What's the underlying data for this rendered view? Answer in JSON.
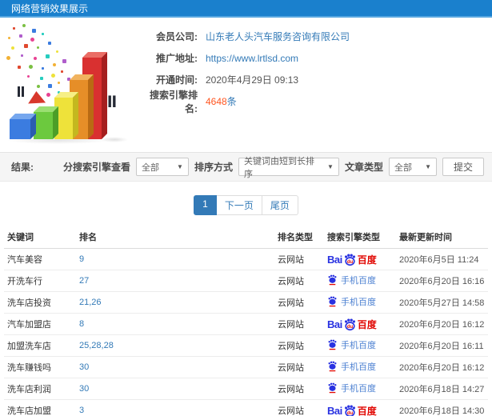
{
  "header": {
    "title": "网络营销效果展示"
  },
  "info": {
    "rows": [
      {
        "label": "会员公司:",
        "value": "山东老人头汽车服务咨询有限公司"
      },
      {
        "label": "推广地址:",
        "value": "https://www.lrtlsd.com"
      },
      {
        "label": "开通时间:",
        "value": "2020年4月29日 09:13"
      },
      {
        "label": "搜索引擎排名:",
        "value": "4648",
        "suffix": "条"
      }
    ]
  },
  "filters": {
    "result_label": "结果:",
    "engine_filter_label": "分搜索引擎查看",
    "engine_filter_value": "全部",
    "sort_label": "排序方式",
    "sort_value": "关键词由短到长排序",
    "article_type_label": "文章类型",
    "article_type_value": "全部",
    "submit_label": "提交",
    "caret": "▼"
  },
  "pagination": {
    "current": "1",
    "next_label": "下一页",
    "last_label": "尾页"
  },
  "table": {
    "headers": [
      "关键词",
      "排名",
      "排名类型",
      "搜索引擎类型",
      "最新更新时间"
    ],
    "engines": {
      "baidu": {
        "latin": "Bai",
        "du": "du",
        "cn": "百度"
      },
      "mobile": {
        "cn": "手机百度"
      }
    },
    "rows": [
      {
        "keyword": "汽车美容",
        "rank": "9",
        "rank_type": "云网站",
        "engine": "baidu",
        "updated": "2020年6月5日 11:24"
      },
      {
        "keyword": "开洗车行",
        "rank": "27",
        "rank_type": "云网站",
        "engine": "mobile",
        "updated": "2020年6月20日 16:16"
      },
      {
        "keyword": "洗车店投资",
        "rank": "21,26",
        "rank_type": "云网站",
        "engine": "mobile",
        "updated": "2020年5月27日 14:58"
      },
      {
        "keyword": "汽车加盟店",
        "rank": "8",
        "rank_type": "云网站",
        "engine": "baidu",
        "updated": "2020年6月20日 16:12"
      },
      {
        "keyword": "加盟洗车店",
        "rank": "25,28,28",
        "rank_type": "云网站",
        "engine": "mobile",
        "updated": "2020年6月20日 16:11"
      },
      {
        "keyword": "洗车赚钱吗",
        "rank": "30",
        "rank_type": "云网站",
        "engine": "mobile",
        "updated": "2020年6月20日 16:12"
      },
      {
        "keyword": "洗车店利润",
        "rank": "30",
        "rank_type": "云网站",
        "engine": "mobile",
        "updated": "2020年6月18日 14:27"
      },
      {
        "keyword": "洗车店加盟",
        "rank": "3",
        "rank_type": "云网站",
        "engine": "baidu",
        "updated": "2020年6月18日 14:30"
      }
    ]
  },
  "illustration": {
    "bar_colors": [
      "#3b7ce0",
      "#6cc93e",
      "#eee23a",
      "#e68e28",
      "#d93030"
    ],
    "confetti_colors": [
      "#e0492f",
      "#7bc043",
      "#3b7ce0",
      "#f2b134",
      "#b05ecc",
      "#e84393",
      "#27cdbf",
      "#eee23a"
    ]
  },
  "colors": {
    "header_bg": "#1a80cd",
    "accent_blue": "#337ab7",
    "highlight_orange": "#ff5722",
    "baidu_blue": "#2932e1",
    "baidu_red": "#e10601",
    "mobile_baidu_blue": "#4a7fd1"
  }
}
